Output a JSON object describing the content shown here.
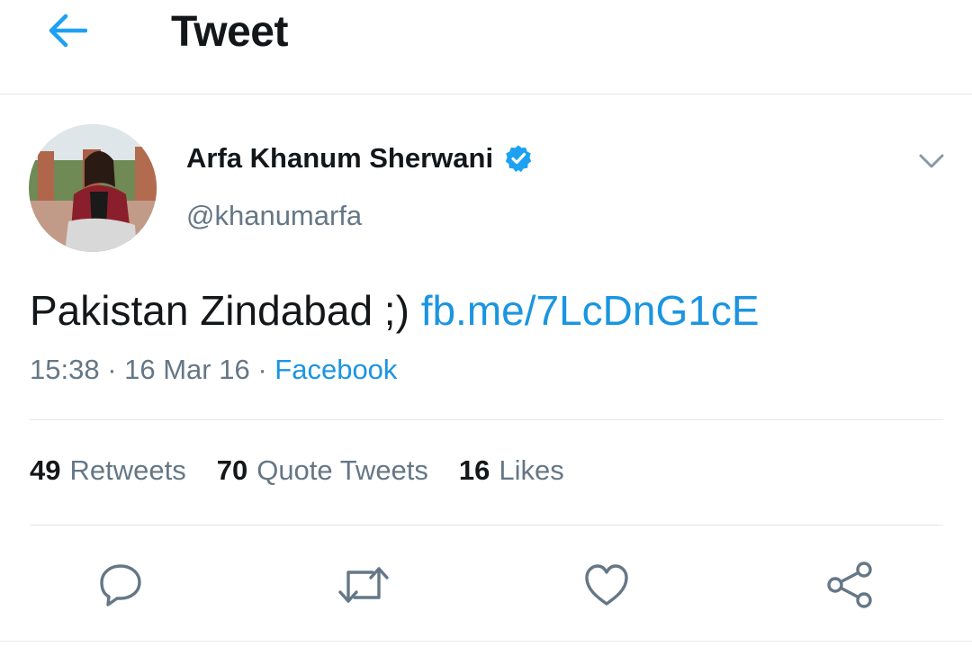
{
  "header": {
    "title": "Tweet",
    "back_icon": "arrow-left-icon"
  },
  "author": {
    "name": "Arfa Khanum Sherwani",
    "handle": "@khanumarfa",
    "verified_icon": "verified-badge-icon",
    "menu_icon": "chevron-down-icon"
  },
  "tweet": {
    "text": "Pakistan Zindabad ;)",
    "link": "fb.me/7LcDnG1cE",
    "time": "15:38",
    "date": "16 Mar 16",
    "source": "Facebook"
  },
  "stats": {
    "retweets_count": "49",
    "retweets_label": "Retweets",
    "quotes_count": "70",
    "quotes_label": "Quote Tweets",
    "likes_count": "16",
    "likes_label": "Likes"
  },
  "actions": [
    "reply-icon",
    "retweet-icon",
    "like-icon",
    "share-icon"
  ],
  "colors": {
    "accent": "#1b95e0",
    "text_primary": "#14171a",
    "text_secondary": "#657786",
    "divider": "#e1e8ed"
  }
}
